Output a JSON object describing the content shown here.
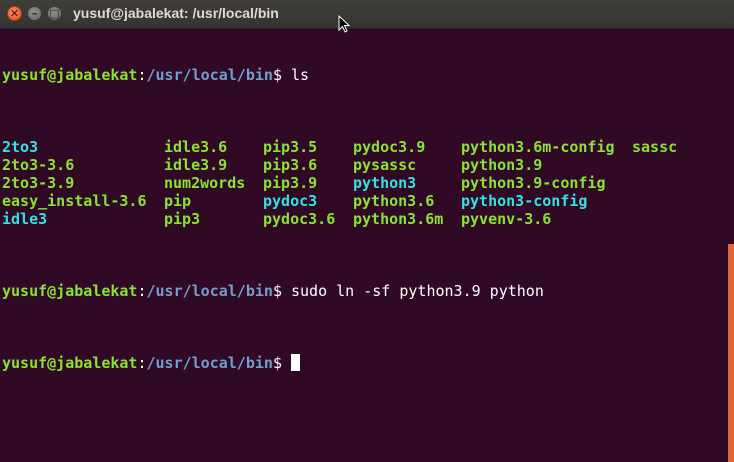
{
  "window": {
    "title": "yusuf@jabalekat: /usr/local/bin",
    "close_glyph": "✕",
    "minimize_glyph": "–",
    "maximize_glyph": "□"
  },
  "colors": {
    "background": "#300a24",
    "prompt_user": "#8ae234",
    "prompt_path": "#729fcf",
    "symlink": "#34e2e2",
    "scroll_thumb": "#e0683a"
  },
  "prompt": {
    "user_host": "yusuf@jabalekat",
    "colon": ":",
    "path": "/usr/local/bin",
    "symbol": "$ "
  },
  "commands": [
    "ls",
    "sudo ln -sf python3.9 python",
    ""
  ],
  "ls_output": [
    {
      "name": "2to3",
      "type": "link"
    },
    {
      "name": "idle3.6",
      "type": "exec"
    },
    {
      "name": "pip3.5",
      "type": "exec"
    },
    {
      "name": "pydoc3.9",
      "type": "exec"
    },
    {
      "name": "python3.6m-config",
      "type": "exec"
    },
    {
      "name": "sassc",
      "type": "exec"
    },
    {
      "name": "2to3-3.6",
      "type": "exec"
    },
    {
      "name": "idle3.9",
      "type": "exec"
    },
    {
      "name": "pip3.6",
      "type": "exec"
    },
    {
      "name": "pysassc",
      "type": "exec"
    },
    {
      "name": "python3.9",
      "type": "exec"
    },
    {
      "name": "",
      "type": "exec"
    },
    {
      "name": "2to3-3.9",
      "type": "exec"
    },
    {
      "name": "num2words",
      "type": "exec"
    },
    {
      "name": "pip3.9",
      "type": "exec"
    },
    {
      "name": "python3",
      "type": "link"
    },
    {
      "name": "python3.9-config",
      "type": "exec"
    },
    {
      "name": "",
      "type": "exec"
    },
    {
      "name": "easy_install-3.6",
      "type": "exec"
    },
    {
      "name": "pip",
      "type": "exec"
    },
    {
      "name": "pydoc3",
      "type": "link"
    },
    {
      "name": "python3.6",
      "type": "exec"
    },
    {
      "name": "python3-config",
      "type": "link"
    },
    {
      "name": "",
      "type": "exec"
    },
    {
      "name": "idle3",
      "type": "link"
    },
    {
      "name": "pip3",
      "type": "exec"
    },
    {
      "name": "pydoc3.6",
      "type": "exec"
    },
    {
      "name": "python3.6m",
      "type": "exec"
    },
    {
      "name": "pyvenv-3.6",
      "type": "exec"
    },
    {
      "name": "",
      "type": "exec"
    }
  ]
}
